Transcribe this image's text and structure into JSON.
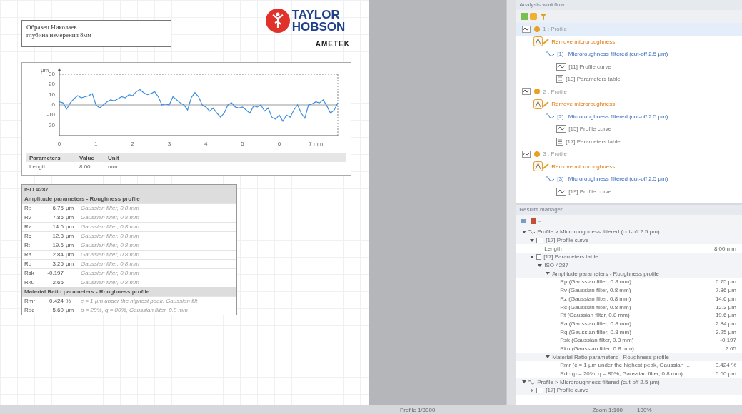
{
  "report": {
    "title_lines": [
      "Образец Николаев",
      "глубина измерения 8мм"
    ],
    "logo": {
      "line1": "TAYLOR",
      "line2": "HOBSON",
      "brand": "AMETEK"
    },
    "chart": {
      "chart_data": {
        "type": "line",
        "ylabel": "µm",
        "xlim": [
          0,
          7.6
        ],
        "ylim": [
          -30,
          30
        ],
        "yticks": [
          -20,
          -10,
          0,
          10,
          20,
          30
        ],
        "xticks": [
          0,
          1,
          2,
          3,
          4,
          5,
          6,
          {
            "value": 7,
            "label": "7 mm"
          }
        ],
        "x": [
          0,
          0.1,
          0.2,
          0.3,
          0.4,
          0.5,
          0.6,
          0.7,
          0.8,
          0.9,
          1,
          1.1,
          1.2,
          1.3,
          1.4,
          1.5,
          1.6,
          1.7,
          1.8,
          1.9,
          2,
          2.1,
          2.2,
          2.3,
          2.4,
          2.5,
          2.6,
          2.7,
          2.8,
          2.9,
          3,
          3.1,
          3.2,
          3.3,
          3.4,
          3.5,
          3.6,
          3.7,
          3.8,
          3.9,
          4,
          4.1,
          4.2,
          4.3,
          4.4,
          4.5,
          4.6,
          4.7,
          4.8,
          4.9,
          5,
          5.1,
          5.2,
          5.3,
          5.4,
          5.5,
          5.6,
          5.7,
          5.8,
          5.9,
          6,
          6.1,
          6.2,
          6.3,
          6.4,
          6.5,
          6.6,
          6.7,
          6.8,
          6.9,
          7,
          7.1,
          7.2,
          7.3,
          7.4,
          7.5,
          7.6
        ],
        "series": [
          {
            "color": "#3a8ee0",
            "values": [
              3,
              2,
              -4,
              2,
              6,
              9,
              7,
              8,
              9,
              11,
              0,
              -3,
              0,
              3,
              5,
              4,
              6,
              8,
              7,
              10,
              9,
              13,
              15,
              12,
              10,
              11,
              13,
              8,
              0,
              1,
              0,
              8,
              5,
              2,
              0,
              -5,
              7,
              12,
              8,
              0,
              -2,
              -6,
              -3,
              -8,
              -12,
              -8,
              0,
              2,
              -2,
              -3,
              -2,
              -5,
              -8,
              -1,
              -2,
              0,
              -6,
              -3,
              -12,
              -14,
              -10,
              -16,
              -10,
              -12,
              -5,
              0,
              -8,
              -13,
              0,
              1,
              3,
              2,
              5,
              -1,
              -8,
              -5,
              2
            ]
          }
        ]
      },
      "params_header": [
        "Parameters",
        "Value",
        "Unit"
      ],
      "params_rows": [
        [
          "Length",
          "8.00",
          "mm"
        ]
      ]
    },
    "iso_table": {
      "title": "ISO 4287",
      "sections": [
        {
          "heading": "Amplitude parameters - Roughness profile",
          "rows": [
            [
              "Rp",
              "6.75",
              "µm",
              "Gaussian filter, 0.8 mm"
            ],
            [
              "Rv",
              "7.86",
              "µm",
              "Gaussian filter, 0.8 mm"
            ],
            [
              "Rz",
              "14.6",
              "µm",
              "Gaussian filter, 0.8 mm"
            ],
            [
              "Rc",
              "12.3",
              "µm",
              "Gaussian filter, 0.8 mm"
            ],
            [
              "Rt",
              "19.6",
              "µm",
              "Gaussian filter, 0.8 mm"
            ],
            [
              "Ra",
              "2.84",
              "µm",
              "Gaussian filter, 0.8 mm"
            ],
            [
              "Rq",
              "3.25",
              "µm",
              "Gaussian filter, 0.8 mm"
            ],
            [
              "Rsk",
              "-0.197",
              "",
              "Gaussian filter, 0.8 mm"
            ],
            [
              "Rku",
              "2.65",
              "",
              "Gaussian filter, 0.8 mm"
            ]
          ]
        },
        {
          "heading": "Material Ratio parameters - Roughness profile",
          "rows": [
            [
              "Rmr",
              "0.424",
              "%",
              "c = 1 µm under the highest peak, Gaussian filt"
            ],
            [
              "Rdc",
              "5.60",
              "µm",
              "p = 20%, q = 80%, Gaussian filter, 0.8 mm"
            ]
          ]
        }
      ]
    }
  },
  "workflow": {
    "title": "Analysis workflow",
    "items": [
      {
        "label": "1 : Profile",
        "selected": true,
        "children": [
          {
            "label": "Remove microroughness",
            "kind": "operator",
            "children": [
              {
                "label": "[1] : Microroughness filtered (cut-off 2.5 µm)",
                "kind": "study",
                "children": [
                  {
                    "label": "[11] Profile curve",
                    "kind": "curve"
                  },
                  {
                    "label": "[13] Parameters table",
                    "kind": "table"
                  }
                ]
              }
            ]
          }
        ]
      },
      {
        "label": "2 : Profile",
        "selected": false,
        "children": [
          {
            "label": "Remove microroughness",
            "kind": "operator",
            "children": [
              {
                "label": "[2] : Microroughness filtered (cut-off 2.5 µm)",
                "kind": "study",
                "children": [
                  {
                    "label": "[15] Profile curve",
                    "kind": "curve"
                  },
                  {
                    "label": "[17] Parameters table",
                    "kind": "table"
                  }
                ]
              }
            ]
          }
        ]
      },
      {
        "label": "3 : Profile",
        "selected": false,
        "children": [
          {
            "label": "Remove microroughness",
            "kind": "operator",
            "children": [
              {
                "label": "[3] : Microroughness filtered (cut-off 2.5 µm)",
                "kind": "study",
                "children": [
                  {
                    "label": "[19] Profile curve",
                    "kind": "curve"
                  }
                ]
              }
            ]
          }
        ]
      }
    ]
  },
  "results": {
    "title": "Results manager",
    "items": [
      {
        "label": "Profile > Microroughness filtered (cut-off 2.5 µm)",
        "kind": "study",
        "expanded": true,
        "children": [
          {
            "label": "[17] Profile curve",
            "kind": "curve",
            "expanded": true,
            "children": [
              {
                "label": "Length",
                "value": "8.00 mm",
                "kind": "value"
              }
            ]
          },
          {
            "label": "[17] Parameters table",
            "kind": "table",
            "expanded": true,
            "children": [
              {
                "label": "ISO 4287",
                "kind": "group",
                "expanded": true,
                "children": [
                  {
                    "label": "Amplitude parameters - Roughness profile",
                    "kind": "group",
                    "expanded": true,
                    "children": [
                      {
                        "label": "Rp (Gaussian filter, 0.8 mm)",
                        "value": "6.75 µm",
                        "kind": "value"
                      },
                      {
                        "label": "Rv (Gaussian filter, 0.8 mm)",
                        "value": "7.86 µm",
                        "kind": "value"
                      },
                      {
                        "label": "Rz (Gaussian filter, 0.8 mm)",
                        "value": "14.6 µm",
                        "kind": "value"
                      },
                      {
                        "label": "Rc (Gaussian filter, 0.8 mm)",
                        "value": "12.3 µm",
                        "kind": "value"
                      },
                      {
                        "label": "Rt (Gaussian filter, 0.8 mm)",
                        "value": "19.6 µm",
                        "kind": "value"
                      },
                      {
                        "label": "Ra (Gaussian filter, 0.8 mm)",
                        "value": "2.84 µm",
                        "kind": "value"
                      },
                      {
                        "label": "Rq (Gaussian filter, 0.8 mm)",
                        "value": "3.25 µm",
                        "kind": "value"
                      },
                      {
                        "label": "Rsk (Gaussian filter, 0.8 mm)",
                        "value": "-0.197",
                        "kind": "value"
                      },
                      {
                        "label": "Rku (Gaussian filter, 0.8 mm)",
                        "value": "2.65",
                        "kind": "value"
                      }
                    ]
                  },
                  {
                    "label": "Material Ratio parameters - Roughness profile",
                    "kind": "group",
                    "expanded": true,
                    "children": [
                      {
                        "label": "Rmr (c = 1 µm under the highest peak, Gaussian ...",
                        "value": "0.424 %",
                        "kind": "value"
                      },
                      {
                        "label": "Rdc (p = 20%, q = 80%, Gaussian filter, 0.8 mm)",
                        "value": "5.60 µm",
                        "kind": "value"
                      }
                    ]
                  }
                ]
              }
            ]
          }
        ]
      },
      {
        "label": "Profile > Microroughness filtered (cut-off 2.5 µm)",
        "kind": "study",
        "expanded": true,
        "children": [
          {
            "label": "[17] Profile curve",
            "kind": "curve",
            "expanded": false
          }
        ]
      }
    ]
  },
  "status_bar": {
    "left": "Profile 1/8000",
    "zoom": "Zoom 1:100",
    "percent": "100%"
  }
}
